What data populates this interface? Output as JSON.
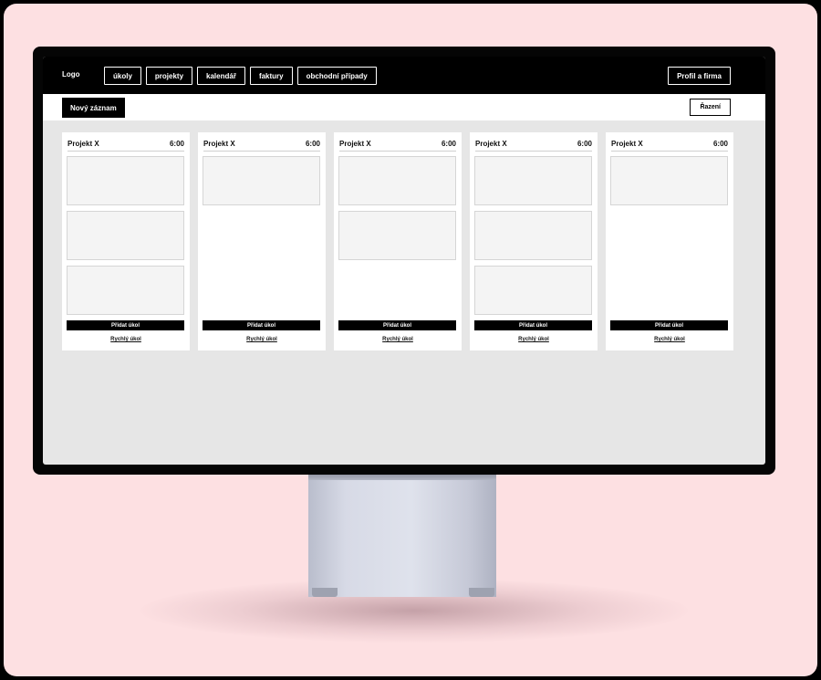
{
  "app": {
    "logo": "Logo",
    "nav": [
      "úkoly",
      "projekty",
      "kalendář",
      "faktury",
      "obchodní případy"
    ],
    "profile_label": "Profil a firma"
  },
  "toolbar": {
    "new_record_label": "Nový záznam",
    "sort_label": "Řazení"
  },
  "columns": [
    {
      "title": "Projekt X",
      "time": "6:00",
      "add_task_label": "Přidat úkol",
      "quick_task_label": "Rychlý úkol"
    },
    {
      "title": "Projekt X",
      "time": "6:00",
      "add_task_label": "Přidat úkol",
      "quick_task_label": "Rychlý úkol"
    },
    {
      "title": "Projekt X",
      "time": "6:00",
      "add_task_label": "Přidat úkol",
      "quick_task_label": "Rychlý úkol"
    },
    {
      "title": "Projekt X",
      "time": "6:00",
      "add_task_label": "Přidat úkol",
      "quick_task_label": "Rychlý úkol"
    },
    {
      "title": "Projekt X",
      "time": "6:00",
      "add_task_label": "Přidat úkol",
      "quick_task_label": "Rychlý úkol"
    }
  ],
  "colors": {
    "background": "#fde0e2",
    "topbar": "#000000",
    "board": "#e6e6e6",
    "card": "#f4f4f4"
  }
}
